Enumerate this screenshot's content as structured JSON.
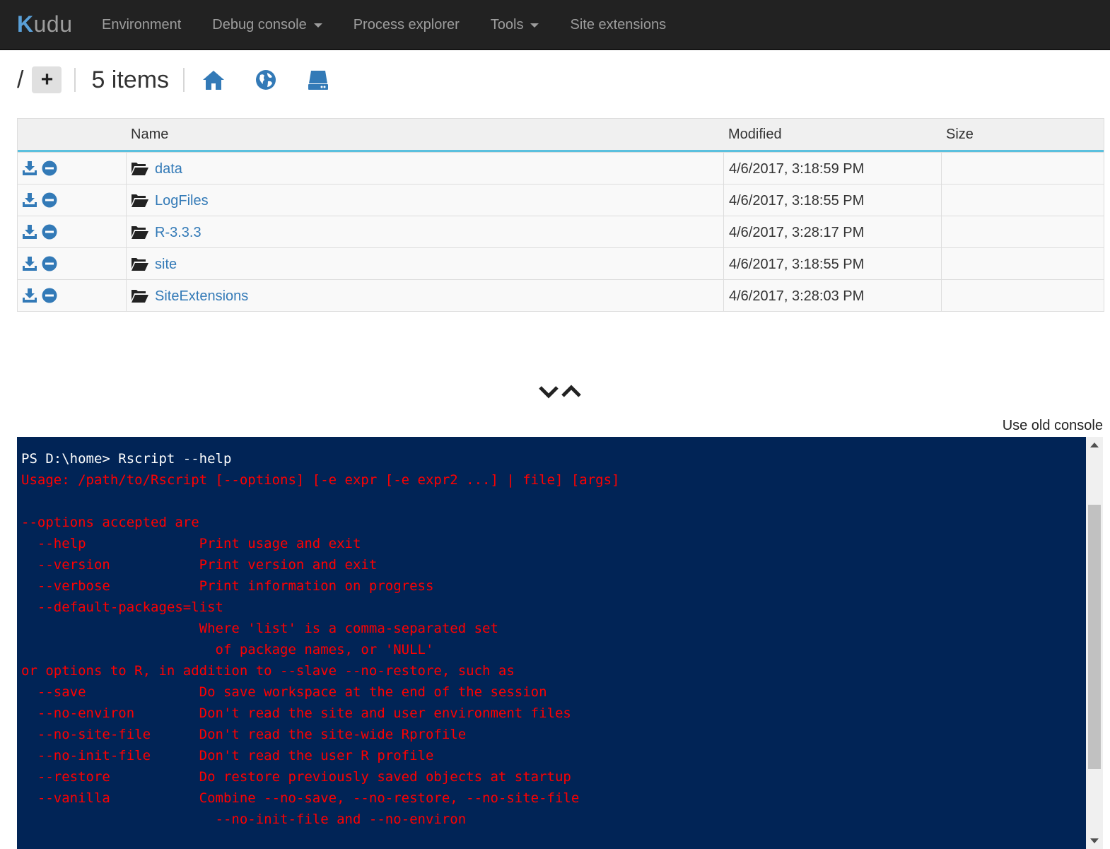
{
  "brand": {
    "k": "K",
    "rest": "udu"
  },
  "nav": [
    {
      "label": "Environment"
    },
    {
      "label": "Debug console",
      "dropdown": true
    },
    {
      "label": "Process explorer"
    },
    {
      "label": "Tools",
      "dropdown": true
    },
    {
      "label": "Site extensions"
    }
  ],
  "pathbar": {
    "path": "/",
    "add_label": "+",
    "item_count": "5 items"
  },
  "table": {
    "headers": {
      "name": "Name",
      "modified": "Modified",
      "size": "Size"
    },
    "rows": [
      {
        "name": "data",
        "modified": "4/6/2017, 3:18:59 PM",
        "size": ""
      },
      {
        "name": "LogFiles",
        "modified": "4/6/2017, 3:18:55 PM",
        "size": ""
      },
      {
        "name": "R-3.3.3",
        "modified": "4/6/2017, 3:28:17 PM",
        "size": ""
      },
      {
        "name": "site",
        "modified": "4/6/2017, 3:18:55 PM",
        "size": ""
      },
      {
        "name": "SiteExtensions",
        "modified": "4/6/2017, 3:28:03 PM",
        "size": ""
      }
    ]
  },
  "console": {
    "old_console_label": "Use old console",
    "prompt": "PS D:\\home> Rscript --help",
    "output": "Usage: /path/to/Rscript [--options] [-e expr [-e expr2 ...] | file] [args]\n\n--options accepted are\n  --help              Print usage and exit\n  --version           Print version and exit\n  --verbose           Print information on progress\n  --default-packages=list\n                      Where 'list' is a comma-separated set\n                        of package names, or 'NULL'\nor options to R, in addition to --slave --no-restore, such as\n  --save              Do save workspace at the end of the session\n  --no-environ        Don't read the site and user environment files\n  --no-site-file      Don't read the site-wide Rprofile\n  --no-init-file      Don't read the user R profile\n  --restore           Do restore previously saved objects at startup\n  --vanilla           Combine --no-save, --no-restore, --no-site-file\n                        --no-init-file and --no-environ"
  },
  "colors": {
    "navbar": "#222222",
    "link": "#337ab7",
    "console_bg": "#012456",
    "console_text": "#ff0000",
    "accent": "#5bc0de"
  }
}
